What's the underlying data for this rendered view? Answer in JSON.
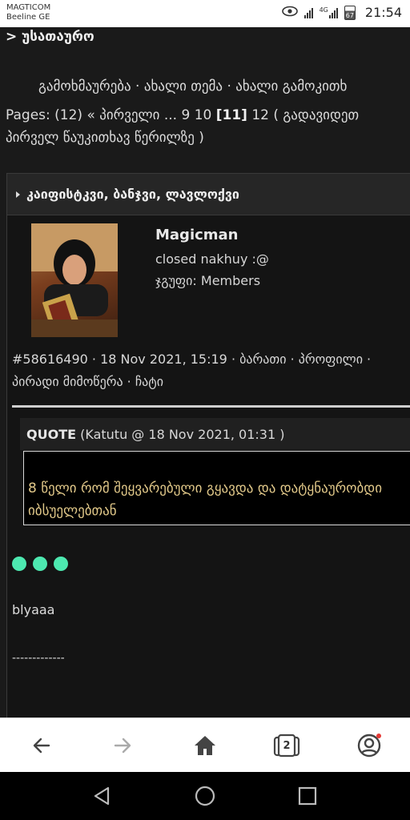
{
  "status_bar": {
    "carrier_line1": "MAGTICOM",
    "carrier_line2": "Beeline GE",
    "network_badge": "4G",
    "battery_level": "67",
    "time": "21:54",
    "icons": [
      "eye-icon",
      "signal-icon",
      "signal-4g-icon",
      "battery-icon"
    ]
  },
  "page": {
    "breadcrumb": "> უსათაურო",
    "actions": "გამოხმაურება · ახალი თემა · ახალი გამოკითხ",
    "pages_prefix": "Pages: (12) « პირველი ... 9 10 ",
    "pages_current": "[11]",
    "pages_suffix": " 12   ( გადავიდეთ პირველ წაუკითხავ წერილზე )"
  },
  "post": {
    "topic_title": "კაიფისტკვი, ბანჯვი, ლავლოქვი",
    "username": "Magicman",
    "user_title": "closed nakhuy :@",
    "user_group": "ჯგუფი: Members",
    "meta": "#58616490 · 18 Nov 2021, 15:19 · ბარათი · პროფილი · პირადი მიმოწერა · ჩატი",
    "quote_label": "QUOTE",
    "quote_source": " (Katutu @ 18 Nov 2021, 01:31 )",
    "quote_text": "8 წელი რომ შეყვარებული გყავდა და დატყნაურობდი იბსუელებთან",
    "body_text": "blyaaa",
    "signature_line": "-------------",
    "accent_color": "#4de8b0",
    "quote_color": "#e1c889"
  },
  "browser_nav": {
    "tab_count": "2",
    "icons": [
      "back-arrow-icon",
      "forward-arrow-icon",
      "home-icon",
      "tabs-icon",
      "account-icon"
    ]
  },
  "system_nav": {
    "icons": [
      "back-triangle-icon",
      "home-circle-icon",
      "recents-square-icon"
    ]
  }
}
